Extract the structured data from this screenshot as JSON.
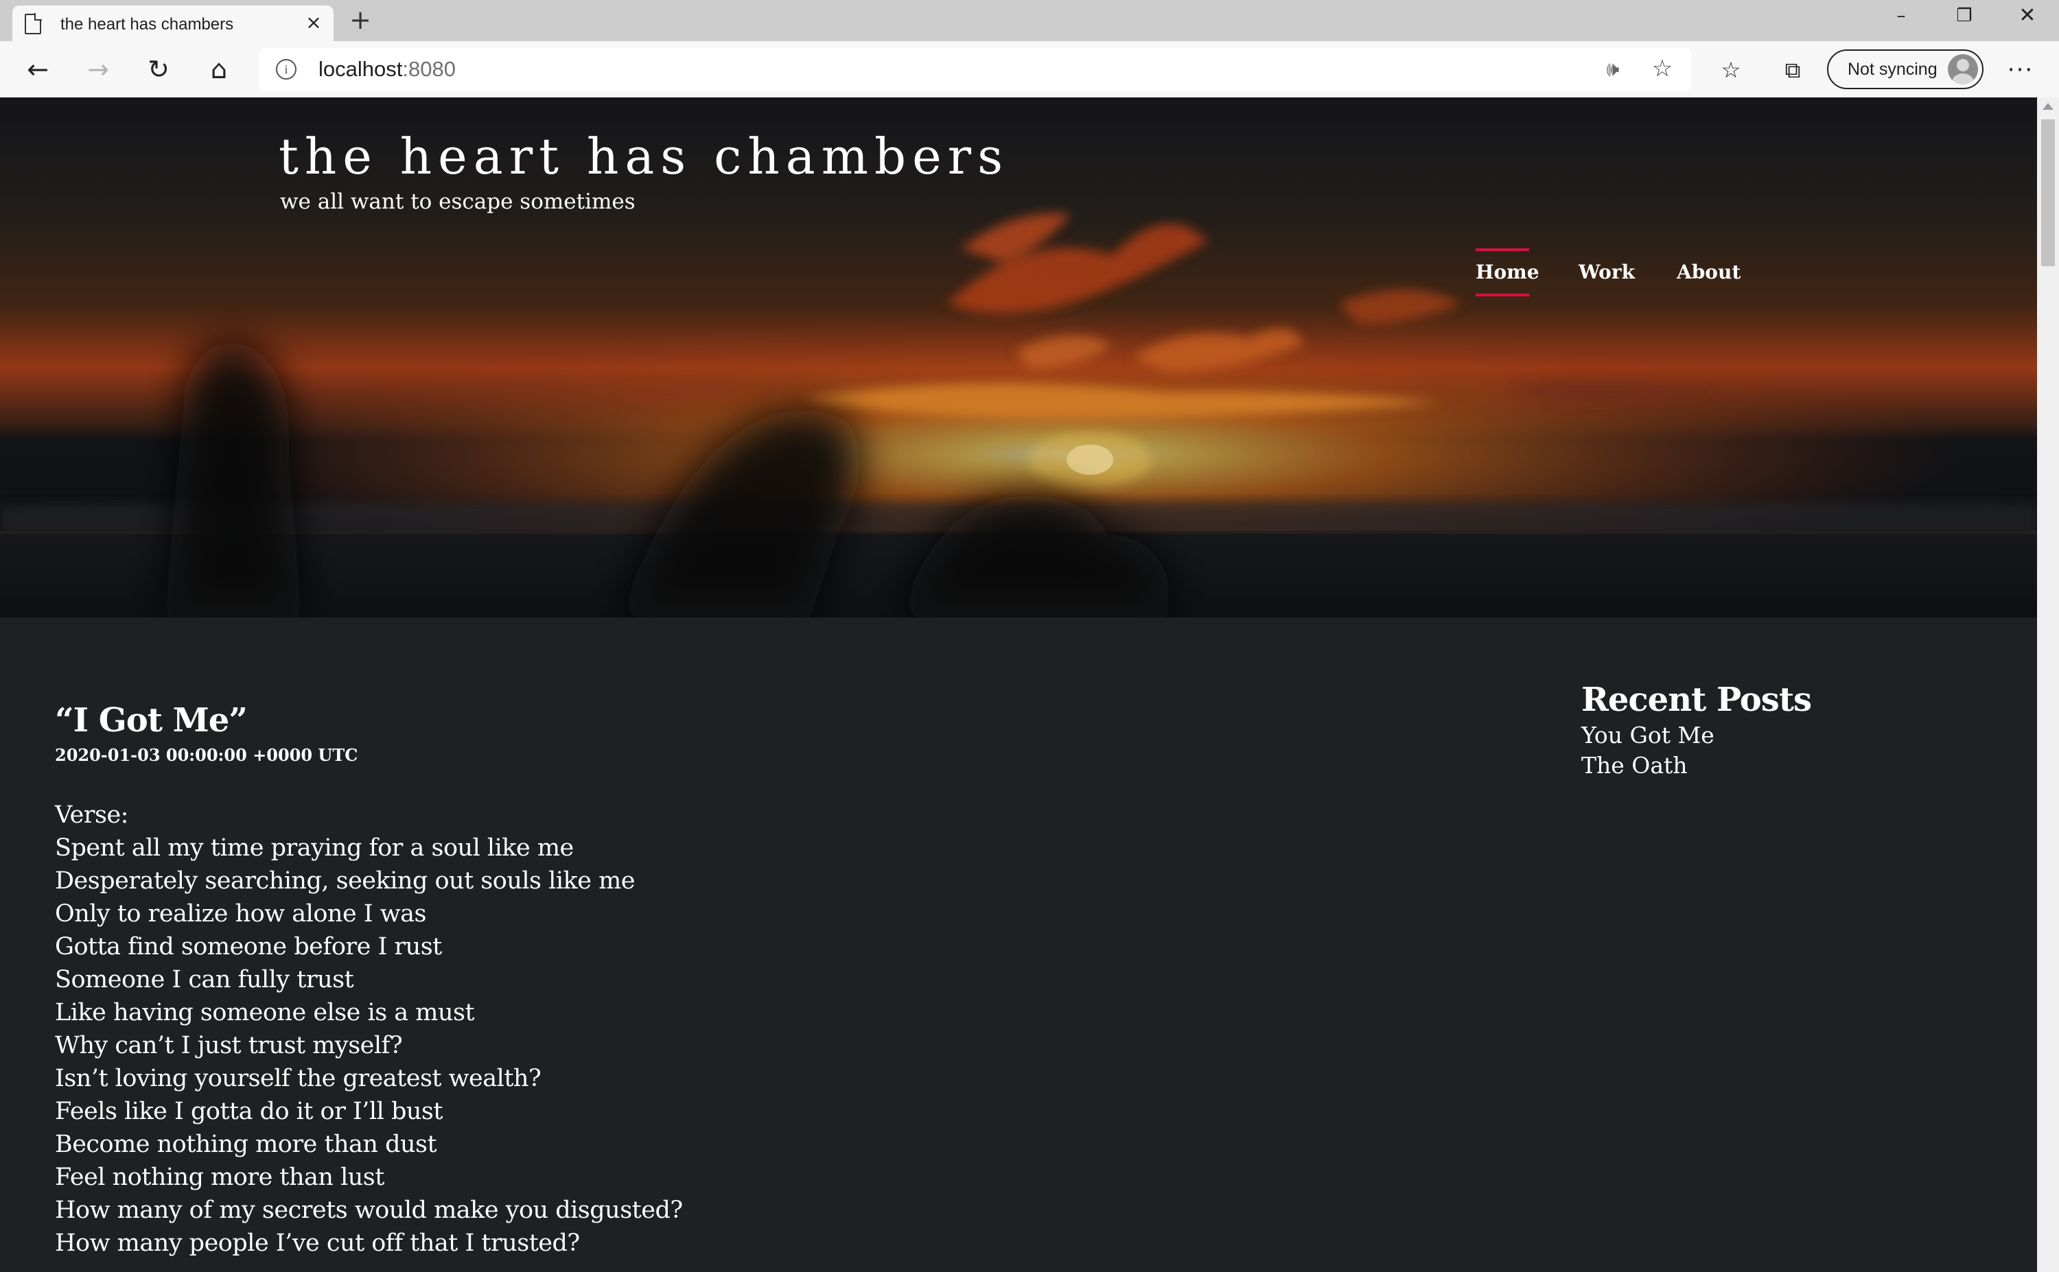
{
  "browser": {
    "tab_title": "the heart has chambers",
    "url_host": "localhost",
    "url_port": ":8080",
    "sync_label": "Not syncing",
    "icons": {
      "tab": "page-icon",
      "close": "close-icon",
      "new_tab": "plus-icon",
      "back": "back-arrow-icon",
      "forward": "forward-arrow-icon",
      "reload": "reload-icon",
      "home": "home-icon",
      "info": "info-icon",
      "read_aloud": "read-aloud-icon",
      "favorite": "star-icon",
      "favorites": "favorites-list-icon",
      "collections": "collections-icon",
      "more": "more-icon"
    }
  },
  "site": {
    "title": "the heart has chambers",
    "tagline": "we all want to escape sometimes",
    "nav": [
      "Home",
      "Work",
      "About"
    ],
    "active_nav": "Home",
    "accent_color": "#d3133d",
    "background_color": "#1f2024"
  },
  "post": {
    "title": "“I Got Me”",
    "date": "2020-01-03 00:00:00 +0000 UTC",
    "lines": [
      "Verse:",
      "Spent all my time praying for a soul like me",
      "Desperately searching, seeking out souls like me",
      "Only to realize how alone I was",
      "Gotta find someone before I rust",
      "Someone I can fully trust",
      "Like having someone else is a must",
      "Why can’t I just trust myself?",
      "Isn’t loving yourself the greatest wealth?",
      "Feels like I gotta do it or I’ll bust",
      "Become nothing more than dust",
      "Feel nothing more than lust",
      "How many of my secrets would make you disgusted?",
      "How many people I’ve cut off that I trusted?"
    ]
  },
  "sidebar": {
    "heading": "Recent Posts",
    "posts": [
      "You Got Me",
      "The Oath"
    ]
  }
}
